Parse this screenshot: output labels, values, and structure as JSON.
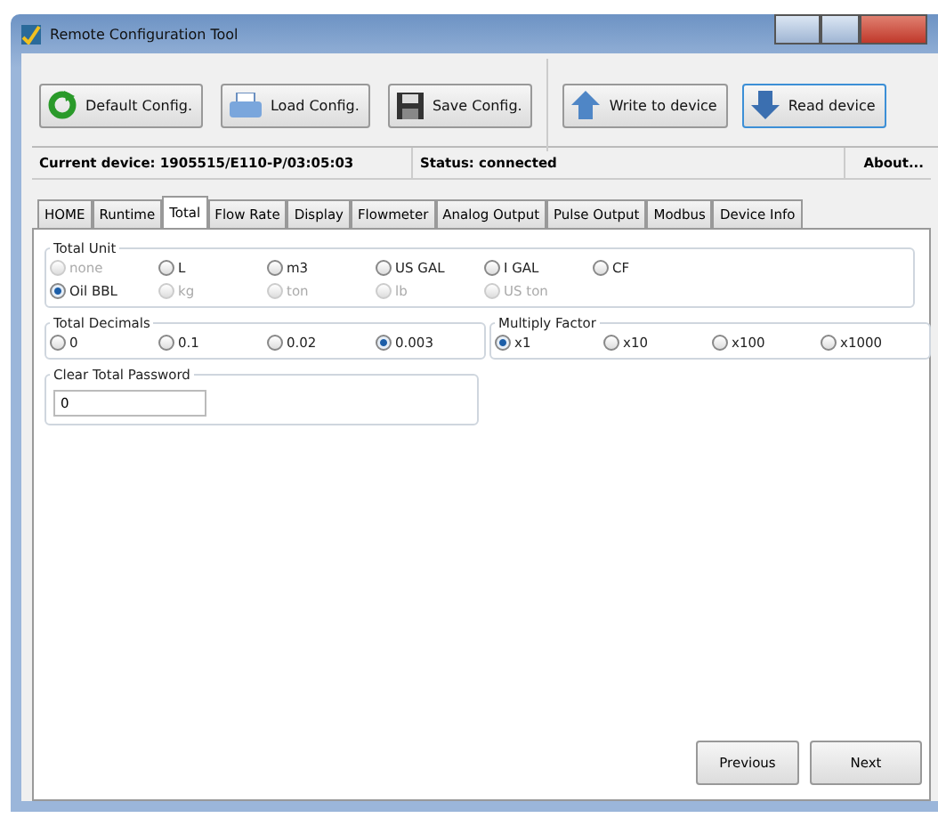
{
  "window": {
    "title": "Remote Configuration Tool"
  },
  "toolbar": {
    "left": [
      "Default Config.",
      "Load Config.",
      "Save Config."
    ],
    "right": [
      "Write to device",
      "Read device"
    ]
  },
  "status_bar": {
    "device": "Current device: 1905515/E110-P/03:05:03",
    "status": "Status: connected",
    "about": "About..."
  },
  "tabs": [
    {
      "label": "HOME",
      "selected": false
    },
    {
      "label": "Runtime",
      "selected": false
    },
    {
      "label": "Total",
      "selected": true
    },
    {
      "label": "Flow Rate",
      "selected": false
    },
    {
      "label": "Display",
      "selected": false
    },
    {
      "label": "Flowmeter",
      "selected": false
    },
    {
      "label": "Analog Output",
      "selected": false
    },
    {
      "label": "Pulse Output",
      "selected": false
    },
    {
      "label": "Modbus",
      "selected": false
    },
    {
      "label": "Device Info",
      "selected": false
    }
  ],
  "total_unit": {
    "title": "Total Unit",
    "options": [
      {
        "label": "none",
        "selected": false,
        "disabled": true
      },
      {
        "label": "L",
        "selected": false,
        "disabled": false
      },
      {
        "label": "m3",
        "selected": false,
        "disabled": false
      },
      {
        "label": "US GAL",
        "selected": false,
        "disabled": false
      },
      {
        "label": "I GAL",
        "selected": false,
        "disabled": false
      },
      {
        "label": "CF",
        "selected": false,
        "disabled": false
      },
      {
        "label": "Oil BBL",
        "selected": true,
        "disabled": false
      },
      {
        "label": "kg",
        "selected": false,
        "disabled": true
      },
      {
        "label": "ton",
        "selected": false,
        "disabled": true
      },
      {
        "label": "lb",
        "selected": false,
        "disabled": true
      },
      {
        "label": "US ton",
        "selected": false,
        "disabled": true
      }
    ]
  },
  "total_decimals": {
    "title": "Total Decimals",
    "options": [
      {
        "label": "0",
        "selected": false,
        "disabled": false
      },
      {
        "label": "0.1",
        "selected": false,
        "disabled": false
      },
      {
        "label": "0.02",
        "selected": false,
        "disabled": false
      },
      {
        "label": "0.003",
        "selected": true,
        "disabled": false
      }
    ]
  },
  "multiply_factor": {
    "title": "Multiply Factor",
    "options": [
      {
        "label": "x1",
        "selected": true,
        "disabled": false
      },
      {
        "label": "x10",
        "selected": false,
        "disabled": false
      },
      {
        "label": "x100",
        "selected": false,
        "disabled": false
      },
      {
        "label": "x1000",
        "selected": false,
        "disabled": false
      }
    ]
  },
  "clear_total_password": {
    "title": "Clear Total Password",
    "value": "0"
  },
  "buttons": [
    "Previous",
    "Next"
  ]
}
